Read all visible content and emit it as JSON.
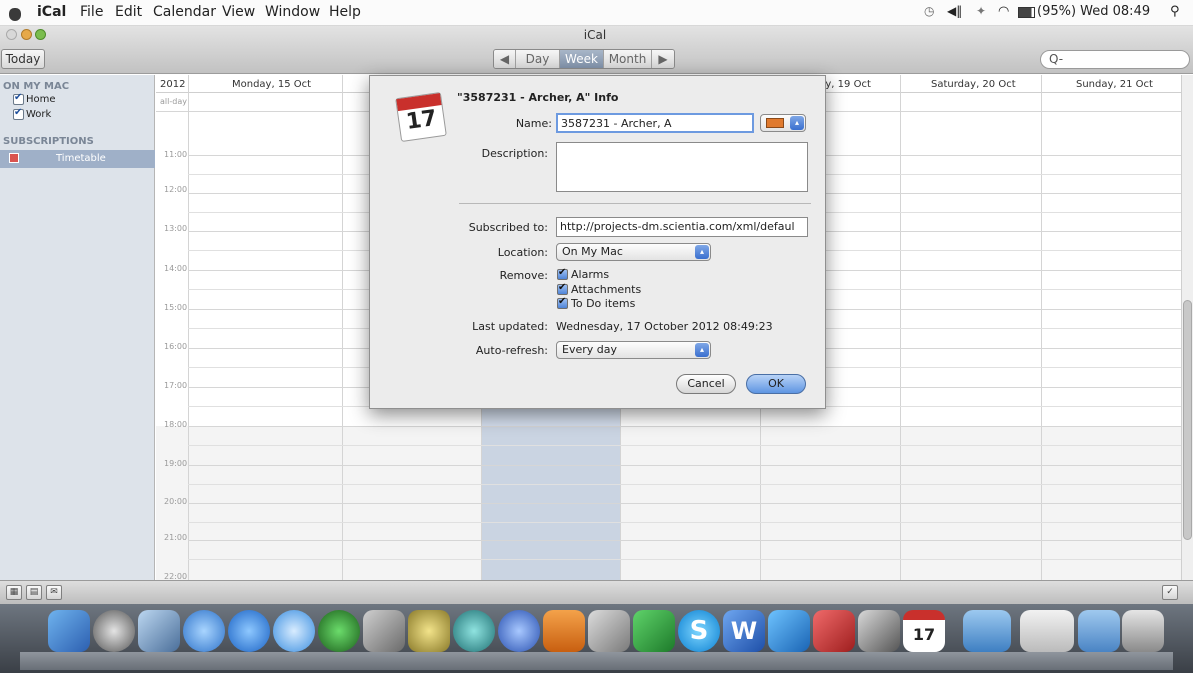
{
  "menubar": {
    "app_name": "iCal",
    "items": [
      "File",
      "Edit",
      "Calendar",
      "View",
      "Window",
      "Help"
    ],
    "status_right": "(95%) Wed 08:49",
    "icons": [
      "time-machine-icon",
      "volume-icon",
      "bluetooth-icon",
      "wifi-icon",
      "battery-icon",
      "spotlight-icon"
    ]
  },
  "window": {
    "title": "iCal",
    "today_label": "Today",
    "views": [
      "Day",
      "Week",
      "Month"
    ],
    "active_view": "Week",
    "search_placeholder": "Q-"
  },
  "sidebar": {
    "sections": [
      {
        "title": "ON MY MAC",
        "items": [
          {
            "label": "Home",
            "checked": true
          },
          {
            "label": "Work",
            "checked": true
          }
        ]
      },
      {
        "title": "SUBSCRIPTIONS",
        "items": [
          {
            "label": "Timetable",
            "checked": true,
            "selected": true
          }
        ]
      }
    ]
  },
  "calendar": {
    "year": "2012",
    "allday_label": "all-day",
    "day_headers": [
      "Monday, 15 Oct",
      "",
      "",
      "",
      "Friday, 19 Oct",
      "Saturday, 20 Oct",
      "Sunday, 21 Oct"
    ],
    "times": [
      "11:00",
      "12:00",
      "13:00",
      "14:00",
      "15:00",
      "16:00",
      "17:00",
      "18:00",
      "19:00",
      "20:00",
      "21:00",
      "22:00"
    ]
  },
  "dialog": {
    "title": "\"3587231 - Archer, A\" Info",
    "icon_day": "17",
    "name_label": "Name:",
    "name_value": "3587231 - Archer, A",
    "color_swatch": "#e07a2e",
    "description_label": "Description:",
    "description_value": "",
    "subscribed_label": "Subscribed to:",
    "subscribed_value": "http://projects-dm.scientia.com/xml/defaul",
    "location_label": "Location:",
    "location_value": "On My Mac",
    "remove_label": "Remove:",
    "remove_options": [
      {
        "label": "Alarms",
        "checked": true
      },
      {
        "label": "Attachments",
        "checked": true
      },
      {
        "label": "To Do items",
        "checked": true
      }
    ],
    "last_updated_label": "Last updated:",
    "last_updated_value": "Wednesday, 17 October 2012 08:49:23",
    "autorefresh_label": "Auto-refresh:",
    "autorefresh_value": "Every day",
    "cancel_label": "Cancel",
    "ok_label": "OK"
  },
  "dock": {
    "calendar_day": "17",
    "skype_letter": "S",
    "word_letter": "W"
  }
}
